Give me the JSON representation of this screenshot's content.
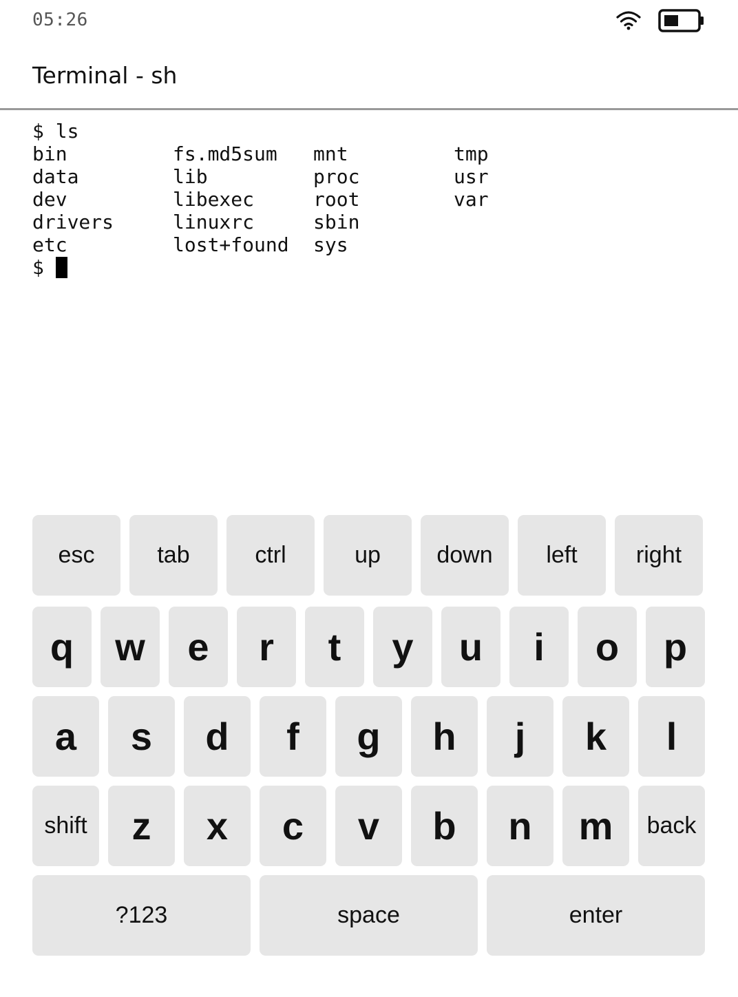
{
  "status": {
    "time": "05:26"
  },
  "title": "Terminal - sh",
  "terminal": {
    "command_line": "$ ls",
    "ls_rows": [
      [
        "bin",
        "fs.md5sum",
        "mnt",
        "tmp"
      ],
      [
        "data",
        "lib",
        "proc",
        "usr"
      ],
      [
        "dev",
        "libexec",
        "root",
        "var"
      ],
      [
        "drivers",
        "linuxrc",
        "sbin",
        ""
      ],
      [
        "etc",
        "lost+found",
        "sys",
        ""
      ]
    ],
    "prompt": "$"
  },
  "keyboard": {
    "function_row": [
      "esc",
      "tab",
      "ctrl",
      "up",
      "down",
      "left",
      "right"
    ],
    "row1": [
      "q",
      "w",
      "e",
      "r",
      "t",
      "y",
      "u",
      "i",
      "o",
      "p"
    ],
    "row2": [
      "a",
      "s",
      "d",
      "f",
      "g",
      "h",
      "j",
      "k",
      "l"
    ],
    "row3": [
      "shift",
      "z",
      "x",
      "c",
      "v",
      "b",
      "n",
      "m",
      "back"
    ],
    "bottom_row": [
      "?123",
      "space",
      "enter"
    ]
  }
}
